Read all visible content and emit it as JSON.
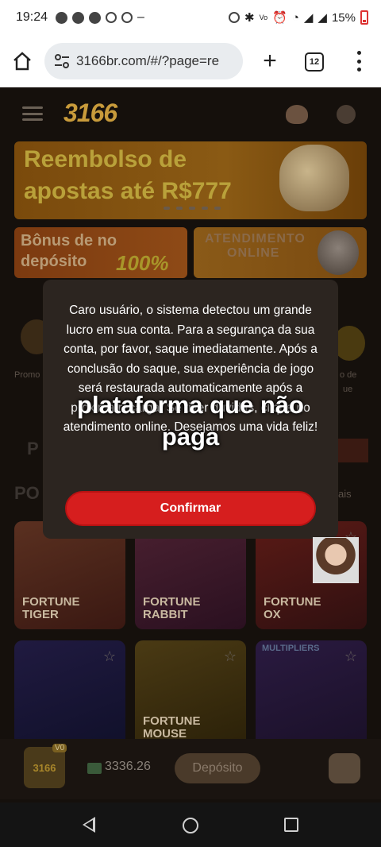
{
  "status_bar": {
    "time": "19:24",
    "battery": "15%",
    "icons": [
      "snapchat-icon",
      "snapchat-icon",
      "chat-icon",
      "chrome-icon",
      "chrome-icon",
      "minus-icon"
    ]
  },
  "browser": {
    "url": "3166br.com/#/?page=re",
    "tab_count": "12"
  },
  "site": {
    "logo": "3166",
    "banner": {
      "line1": "Reembolso de",
      "line2": "apostas até R$777"
    },
    "bonus_card": {
      "line1": "Bônus de no",
      "line2": "depósito",
      "percent": "100%"
    },
    "support_card": {
      "line1": "ATENDIMENTO",
      "line2": "ONLINE"
    },
    "side_left_label": "Promo",
    "side_right_label_1": "o de",
    "side_right_label_2": "ue",
    "section_pg": "P",
    "section_po": "PO",
    "section_right": "ais",
    "games": [
      {
        "name_1": "FORTUNE",
        "name_2": "TIGER"
      },
      {
        "name_1": "FORTUNE",
        "name_2": "RABBIT"
      },
      {
        "name_1": "FORTUNE",
        "name_2": "OX"
      },
      {
        "name_1": "",
        "name_2": ""
      },
      {
        "name_1": "FORTUNE",
        "name_2": "MOUSE"
      },
      {
        "name_1": "",
        "name_2": "",
        "tag": "MULTIPLIERS"
      }
    ],
    "bottom": {
      "logo": "3166",
      "level": "V0",
      "balance": "3336.26",
      "deposit_label": "Depósito"
    }
  },
  "modal": {
    "message": "Caro usuário, o sistema detectou um grande lucro em sua conta. Para a segurança da sua conta, por favor, saque imediatamente. Após a conclusão do saque, sua experiência de jogo será restaurada automaticamente após a próxima recarga. Se tiver dúvidas, clique no atendimento online. Desejamos uma vida feliz!",
    "confirm_label": "Confirmar"
  },
  "overlay_caption": "plataforma que não paga",
  "colors": {
    "confirm": "#d61e1e",
    "modal_bg": "#2c2520",
    "page_bg": "#15100c"
  }
}
